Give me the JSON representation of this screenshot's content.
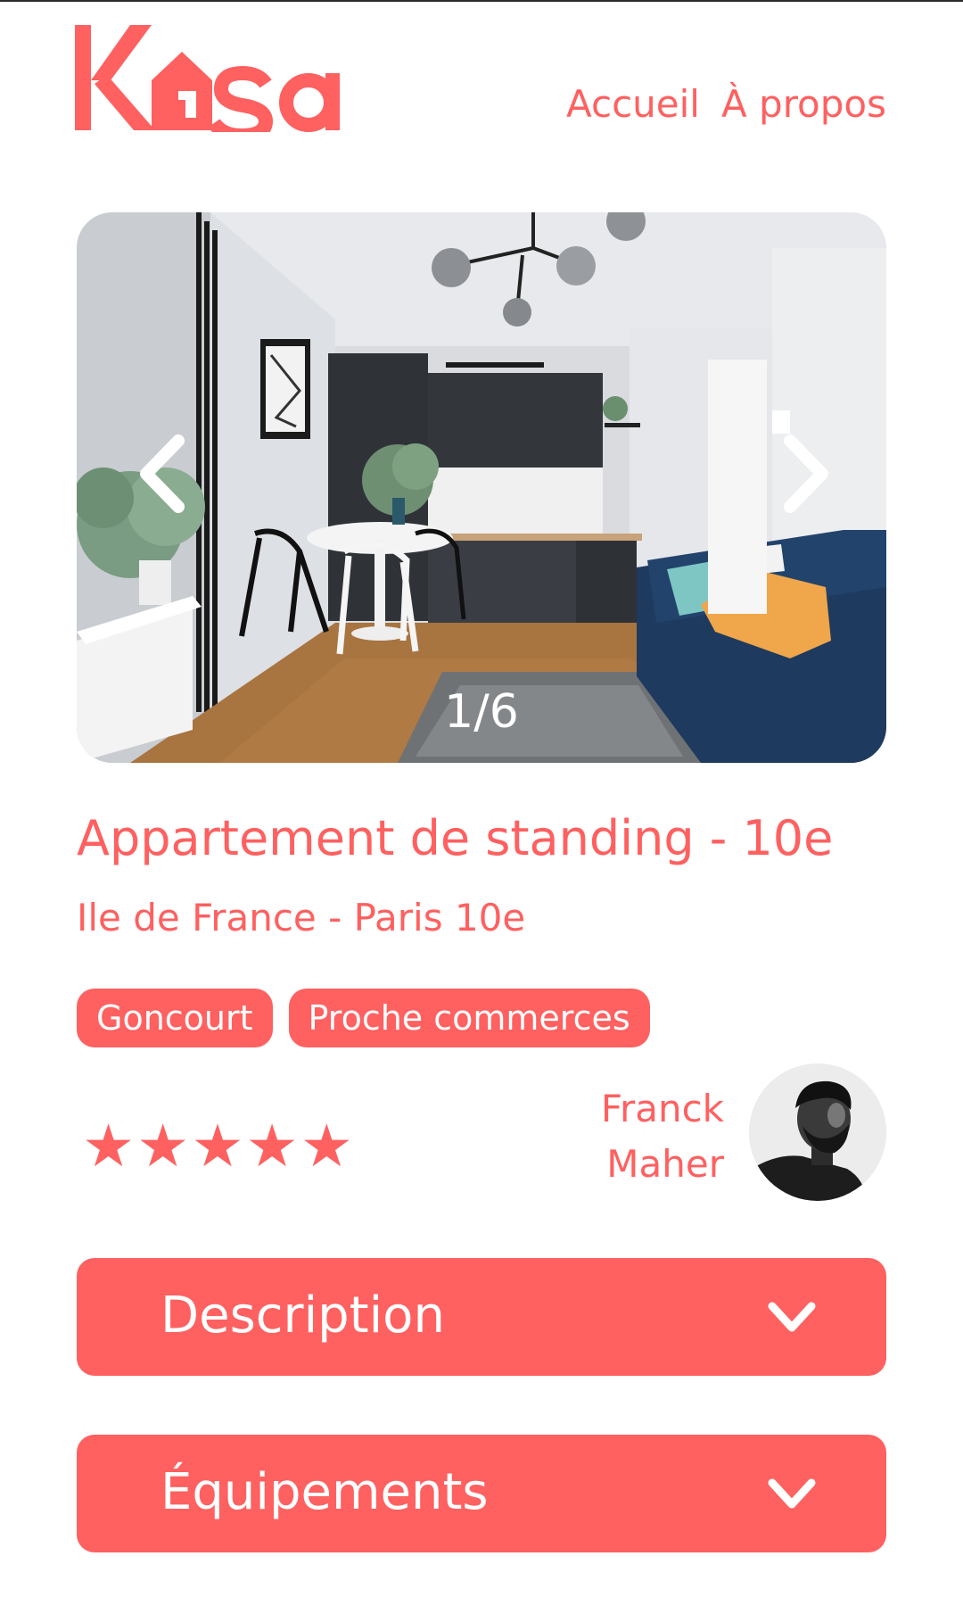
{
  "header": {
    "logo_text": "Kasa",
    "nav": [
      "Accueil",
      "À propos"
    ]
  },
  "carousel": {
    "counter": "1/6"
  },
  "listing": {
    "title": "Appartement de standing - 10e",
    "location": "Ile de France - Paris 10e",
    "tags": [
      "Goncourt",
      "Proche commerces"
    ],
    "rating": 5,
    "rating_max": 5,
    "stars": [
      "★",
      "★",
      "★",
      "★",
      "★"
    ],
    "host": {
      "first_name": "Franck",
      "last_name": "Maher"
    }
  },
  "collapses": [
    "Description",
    "Équipements"
  ],
  "colors": {
    "accent": "#FF6060",
    "background": "#FFFFFF",
    "text_on_accent": "#FFFFFF"
  },
  "icons": [
    "kasa-logo",
    "chevron-left-icon",
    "chevron-right-icon",
    "star-icon",
    "chevron-down-icon"
  ]
}
